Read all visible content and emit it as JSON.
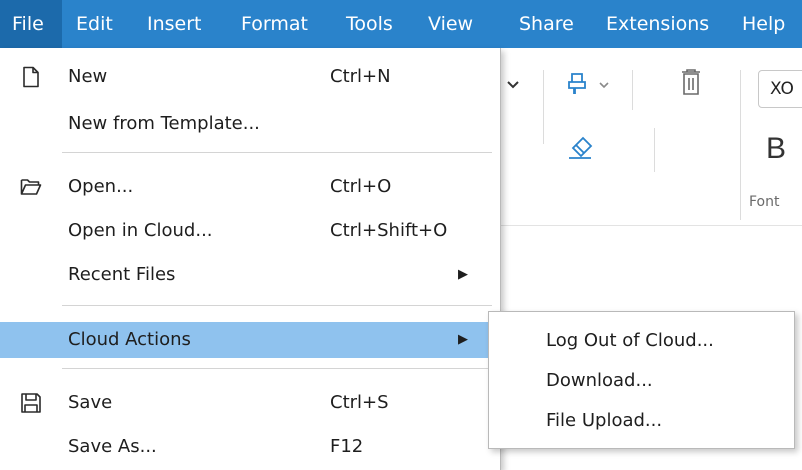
{
  "menubar": {
    "items": [
      {
        "label": "File"
      },
      {
        "label": "Edit"
      },
      {
        "label": "Insert"
      },
      {
        "label": "Format"
      },
      {
        "label": "Tools"
      },
      {
        "label": "View"
      },
      {
        "label": "Share"
      },
      {
        "label": "Extensions"
      },
      {
        "label": "Help"
      }
    ],
    "active": "File"
  },
  "toolbar": {
    "font_name": "XO",
    "bold_label": "B",
    "font_group_label": "Font"
  },
  "file_menu": {
    "items": [
      {
        "label": "New",
        "shortcut": "Ctrl+N",
        "icon": "new-document-icon"
      },
      {
        "label": "New from Template...",
        "shortcut": ""
      },
      {
        "label": "Open...",
        "shortcut": "Ctrl+O",
        "icon": "folder-open-icon"
      },
      {
        "label": "Open in Cloud...",
        "shortcut": "Ctrl+Shift+O"
      },
      {
        "label": "Recent Files",
        "shortcut": "",
        "submenu": true
      },
      {
        "label": "Cloud Actions",
        "shortcut": "",
        "submenu": true,
        "highlighted": true
      },
      {
        "label": "Save",
        "shortcut": "Ctrl+S",
        "icon": "save-icon"
      },
      {
        "label": "Save As...",
        "shortcut": "F12"
      }
    ]
  },
  "cloud_actions_submenu": {
    "items": [
      {
        "label": "Log Out of Cloud..."
      },
      {
        "label": "Download..."
      },
      {
        "label": "File Upload..."
      }
    ]
  },
  "colors": {
    "menubar_bg": "#2a83cb",
    "menubar_active": "#1c6aab",
    "highlight": "#8fc2ee",
    "icon_blue": "#2a83cb"
  }
}
